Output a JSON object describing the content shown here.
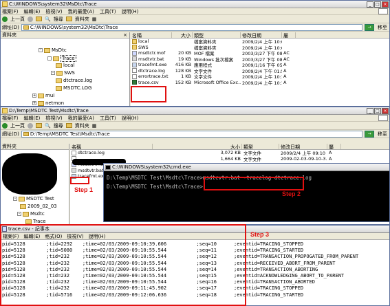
{
  "top_window": {
    "title": "C:\\WINDOWS\\system32\\MsDtc\\Trace",
    "menu": [
      "檔案(F)",
      "編輯(E)",
      "檢視(V)",
      "我的最愛(A)",
      "工具(T)",
      "說明(H)"
    ],
    "toolbar": {
      "back": "上一頁",
      "search": "搜尋",
      "folders": "資料夾"
    },
    "address_label": "網址(D)",
    "address": "C:\\WINDOWS\\system32\\MsDtc\\Trace",
    "go": "移至",
    "tree_header": "資料夾",
    "tree": [
      {
        "label": "MsDtc",
        "exp": "-"
      },
      {
        "label": "Trace",
        "exp": ""
      },
      {
        "label": "local",
        "exp": ""
      },
      {
        "label": "SWS",
        "exp": "-"
      },
      {
        "label": "dtctrace.log",
        "exp": ""
      },
      {
        "label": "MSDTC.LOG",
        "exp": ""
      },
      {
        "label": "mui",
        "exp": "+"
      },
      {
        "label": "netmon",
        "exp": "+"
      }
    ],
    "columns": [
      "名稱",
      "大小",
      "類型",
      "修改日期",
      "屬"
    ],
    "files": [
      {
        "name": "local",
        "size": "",
        "type": "檔案資料夾",
        "date": "2009/2/4 上午 10:02",
        "attr": "",
        "icon": "folder"
      },
      {
        "name": "SWS",
        "size": "",
        "type": "檔案資料夾",
        "date": "2009/2/4 上午 10:05",
        "attr": "",
        "icon": "folder"
      },
      {
        "name": "msdtctr.mof",
        "size": "20 KB",
        "type": "MOF 檔案",
        "date": "2003/3/27 下午 08:00",
        "attr": "AC",
        "icon": "mof"
      },
      {
        "name": "msdtvtr.bat",
        "size": "19 KB",
        "type": "Windows 批次檔案",
        "date": "2003/3/27 下午 08:00",
        "attr": "AC",
        "icon": "bat"
      },
      {
        "name": "tracefmt.exe",
        "size": "416 KB",
        "type": "應用程式",
        "date": "2009/1/16 下午 05:21",
        "attr": "A",
        "icon": "exe"
      },
      {
        "name": "dtctrace.log",
        "size": "128 KB",
        "type": "文字文件",
        "date": "2009/2/4 下午 01:55",
        "attr": "A",
        "icon": "txt"
      },
      {
        "name": "errortrace.txt",
        "size": "1 KB",
        "type": "文字文件",
        "date": "2009/2/4 上午 10:18",
        "attr": "A",
        "icon": "txt"
      },
      {
        "name": "trace.csv",
        "size": "152 KB",
        "type": "Microsoft Office Exc...",
        "date": "2009/2/4 上午 10:18",
        "attr": "A",
        "icon": "csv"
      }
    ]
  },
  "mid_window": {
    "title": "D:\\Temp\\MSDTC Test\\Msdtc\\Trace",
    "menu": [
      "檔案(F)",
      "編輯(E)",
      "檢視(V)",
      "我的最愛(A)",
      "工具(T)",
      "說明(H)"
    ],
    "toolbar": {
      "back": "上一頁",
      "search": "搜尋",
      "folders": "資料夾"
    },
    "address_label": "網址(D)",
    "address": "D:\\Temp\\MSDTC Test\\Msdtc\\Trace",
    "go": "移至",
    "tree_header": "資料夾",
    "tree": [
      {
        "label": "MSDTC Test",
        "exp": "-"
      },
      {
        "label": "2009_02_03",
        "exp": ""
      },
      {
        "label": "Msdtc",
        "exp": "-"
      },
      {
        "label": "Trace",
        "exp": ""
      }
    ],
    "columns": [
      "名稱",
      "大小",
      "類型",
      "修改日期",
      "屬"
    ],
    "files": [
      {
        "name": "dtctrace.log",
        "size": "3,072 KB",
        "type": "文字文件",
        "date": "2009/2/4 上午 09:10",
        "attr": "A",
        "icon": "txt"
      },
      {
        "name": "",
        "size": "1,664 KB",
        "type": "文字文件",
        "date": "2009-02-03-09-10-3...",
        "attr": "A",
        "icon": "txt"
      },
      {
        "name": "msdtctr.mof",
        "size": "",
        "type": "",
        "date": "",
        "attr": "",
        "icon": "mof"
      },
      {
        "name": "msdtvtr.bat",
        "size": "",
        "type": "",
        "date": "",
        "attr": "",
        "icon": "bat"
      },
      {
        "name": "tracefmt.exe",
        "size": "",
        "type": "",
        "date": "",
        "attr": "",
        "icon": "exe"
      }
    ]
  },
  "cmd": {
    "title": "C:\\WINDOWS\\system32\\cmd.exe",
    "line1_prompt": "D:\\Temp\\MSDTC Test\\Msdtc\\Trace>",
    "line1_cmd": "msdtcvtr.bat -tracelog dtctrace.log",
    "line2": "D:\\Temp\\MSDTC Test\\Msdtc\\Trace>"
  },
  "steps": {
    "step1": "Step 1",
    "step2": "Step 2",
    "step3": "Step 3"
  },
  "notepad": {
    "title": "trace.csv - 記事本",
    "menu": [
      "檔案(F)",
      "編輯(E)",
      "格式(O)",
      "檢視(V)",
      "說明(H)"
    ],
    "rows": [
      [
        "pid=5128",
        ";tid=2292",
        ";time=02/03/2009-09:10:39.606",
        ";seq=10",
        ";eventid=TRACING_STOPPED"
      ],
      [
        "pid=5128",
        ";tid=5080",
        ";time=02/03/2009-09:10:55.544",
        ";seq=11",
        ";eventid=TRACING_STARTED"
      ],
      [
        "pid=5128",
        ";tid=232",
        ";time=02/03/2009-09:10:55.544",
        ";seq=12",
        ";eventid=TRANSACTION_PROPOGATED_FROM_PARENT"
      ],
      [
        "pid=5128",
        ";tid=232",
        ";time=02/03/2009-09:10:55.544",
        ";seq=13",
        ";eventid=RECEIVED_ABORT_FROM_PARENT"
      ],
      [
        "pid=5128",
        ";tid=232",
        ";time=02/03/2009-09:10:55.544",
        ";seq=14",
        ";eventid=TRANSACTION_ABORTING"
      ],
      [
        "pid=5128",
        ";tid=232",
        ";time=02/03/2009-09:10:55.544",
        ";seq=15",
        ";eventid=ACKNOWLEDGING_ABORT_TO_PARENT"
      ],
      [
        "pid=5128",
        ";tid=232",
        ";time=02/03/2009-09:10:55.544",
        ";seq=16",
        ";eventid=TRANSACTION_ABORTED"
      ],
      [
        "pid=5128",
        ";tid=232",
        ";time=02/03/2009-09:11:45.902",
        ";seq=17",
        ";eventid=TRACING_STOPPED"
      ],
      [
        "pid=5128",
        ";tid=5716",
        ";time=02/03/2009-09:12:06.636",
        ";seq=18",
        ";eventid=TRACING_STARTED"
      ]
    ]
  }
}
